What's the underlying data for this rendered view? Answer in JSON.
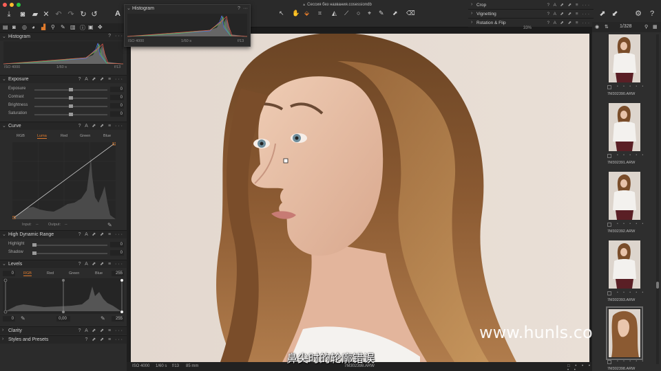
{
  "window": {
    "title": "Сессия без названия.cosessiondb"
  },
  "colors": {
    "accent": "#e07b2c",
    "panel": "#2b2b2b",
    "background": "#1c1c1c"
  },
  "histogram_panel": {
    "title": "Histogram",
    "iso": "ISO 4000",
    "shutter": "1/60 s",
    "aperture": "f/13"
  },
  "floating_histogram": {
    "title": "Histogram",
    "iso": "ISO 4000",
    "shutter": "1/60 s",
    "aperture": "f/13",
    "help": "?",
    "more": "···"
  },
  "exposure": {
    "title": "Exposure",
    "rows": [
      {
        "label": "Exposure",
        "value": "0",
        "level": 0.5
      },
      {
        "label": "Contrast",
        "value": "0",
        "level": 0.5
      },
      {
        "label": "Brightness",
        "value": "0",
        "level": 0.5
      },
      {
        "label": "Saturation",
        "value": "0",
        "level": 0.5
      }
    ]
  },
  "curve": {
    "title": "Curve",
    "tabs": [
      "RGB",
      "Luma",
      "Red",
      "Green",
      "Blue"
    ],
    "active_tab": "Luma",
    "input_label": "Input:",
    "input_value": "--",
    "output_label": "Output:",
    "output_value": "--"
  },
  "hdr": {
    "title": "High Dynamic Range",
    "rows": [
      {
        "label": "Highlight",
        "value": "0",
        "level": 0.0
      },
      {
        "label": "Shadow",
        "value": "0",
        "level": 0.0
      }
    ]
  },
  "levels": {
    "title": "Levels",
    "low_value": "0",
    "high_value": "255",
    "tabs": [
      "RGB",
      "Red",
      "Green",
      "Blue"
    ],
    "active_tab": "RGB",
    "out_low": "0",
    "mid": "0,00",
    "out_high": "255"
  },
  "clarity": {
    "title": "Clarity"
  },
  "styles": {
    "title": "Styles and Presets"
  },
  "right_tools": [
    {
      "title": "Crop"
    },
    {
      "title": "Vignetting"
    },
    {
      "title": "Rotation & Flip"
    }
  ],
  "zoom": "33%",
  "viewer_status": {
    "iso": "ISO 4000",
    "shutter": "1/60 s",
    "aperture": "f/13",
    "focal": "85 mm",
    "filename": "7M302398.ARW"
  },
  "subtitle": "鼻尖时的轮廓错误",
  "watermark": "www.hunls.com",
  "browser": {
    "counter": "1/328",
    "items": [
      {
        "name": "7M302390.ARW"
      },
      {
        "name": "7M302391.ARW"
      },
      {
        "name": "7M302392.ARW"
      },
      {
        "name": "7M302393.ARW"
      },
      {
        "name": "7M302398.ARW"
      }
    ],
    "stars": "• • • • •"
  },
  "panel_tools": "? A ⬈ ⬈ ≡ ···",
  "panel_tools_short": "? ⬈ ⬈ ≡ ···"
}
